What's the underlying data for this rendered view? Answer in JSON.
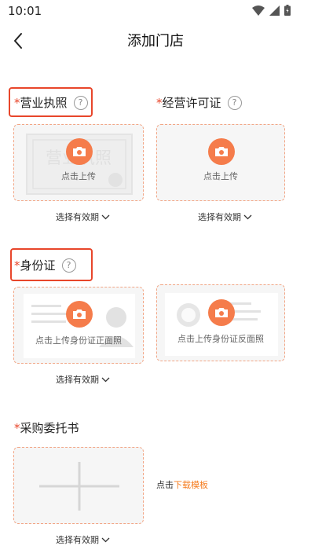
{
  "status_bar": {
    "time": "10:01"
  },
  "header": {
    "title": "添加门店"
  },
  "sections": {
    "business_license": {
      "star": "*",
      "title": "营业执照",
      "upload_text": "点击上传",
      "watermark": "营业执照",
      "validity": "选择有效期"
    },
    "operating_permit": {
      "star": "*",
      "title": "经营许可证",
      "upload_text": "点击上传",
      "validity": "选择有效期"
    },
    "id_card": {
      "star": "*",
      "title": "身份证",
      "front_text": "点击上传身份证正面照",
      "back_text": "点击上传身份证反面照",
      "validity": "选择有效期"
    },
    "purchase_authorization": {
      "star": "*",
      "title": "采购委托书",
      "hint_prefix": "点击",
      "download_link": "下载模板",
      "validity": "选择有效期"
    }
  },
  "colors": {
    "accent": "#f57c4b",
    "required_star": "#e8462b",
    "link": "#f57c1f",
    "highlight_box": "#e8462b"
  },
  "icons": [
    "back-arrow-icon",
    "help-circle-icon",
    "camera-icon",
    "chevron-down-icon",
    "plus-icon",
    "wifi-icon",
    "signal-icon",
    "battery-icon"
  ]
}
